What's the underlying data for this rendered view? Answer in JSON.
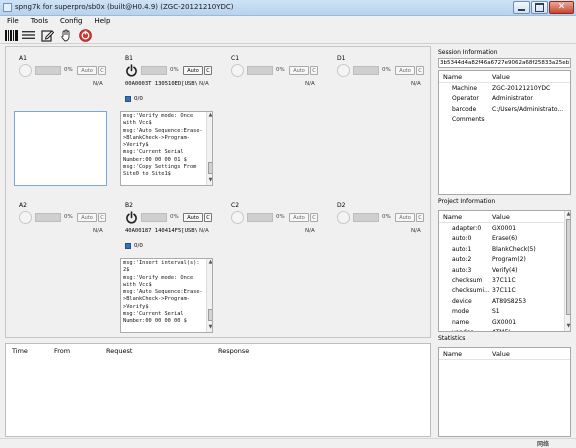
{
  "window": {
    "title": "spng7k for superpro/sb0x (built@H0.4.9) (ZGC-20121210YDC)"
  },
  "menu": [
    "File",
    "Tools",
    "Config",
    "Help"
  ],
  "toolbar": {
    "icons": [
      "barcode-icon",
      "list-icon",
      "edit-icon",
      "hand-icon",
      "stop-icon"
    ]
  },
  "sites": {
    "A1": {
      "label": "A1",
      "pct": "0%",
      "auto": "Auto",
      "c": "C",
      "status": "N/A"
    },
    "B1": {
      "label": "B1",
      "pct": "0%",
      "auto": "Auto",
      "c": "C",
      "status": "N/A",
      "serial": "00A0003T   130510ED[USB\\VID_",
      "count": "0/0",
      "log": "msg:'Verify mode: Once\nwith Vcc$\nmsg:'Auto Sequence:Erase-\n>BlankCheck->Program-\n>Verify$\nmsg:'Current Serial\nNumber:00 00 00 01 $\nmsg:'Copy Settings From\nSite0 to Site1$"
    },
    "C1": {
      "label": "C1",
      "pct": "0%",
      "auto": "Auto",
      "c": "C",
      "status": "N/A"
    },
    "D1": {
      "label": "D1",
      "pct": "0%",
      "auto": "Auto",
      "c": "C",
      "status": "N/A"
    },
    "A2": {
      "label": "A2",
      "pct": "0%",
      "auto": "Auto",
      "c": "C",
      "status": "N/A"
    },
    "B2": {
      "label": "B2",
      "pct": "0%",
      "auto": "Auto",
      "c": "C",
      "status": "N/A",
      "serial": "40A00187   140414F5[USB\\VID_",
      "count": "0/0",
      "log": "msg:'Insert interval(s):\n2$\nmsg:'Verify mode: Once\nwith Vcc$\nmsg:'Auto Sequence:Erase-\n>BlankCheck->Program-\n>Verify$\nmsg:'Current Serial\nNumber:00 00 00 00 $"
    },
    "C2": {
      "label": "C2",
      "pct": "0%",
      "auto": "Auto",
      "c": "C",
      "status": "N/A"
    },
    "D2": {
      "label": "D2",
      "pct": "0%",
      "auto": "Auto",
      "c": "C",
      "status": "N/A"
    }
  },
  "log_table": {
    "columns": [
      "Time",
      "From",
      "Request",
      "Response"
    ]
  },
  "session": {
    "title": "Session Information",
    "id": "3b5344d4a82f46a6727e9062a68f25833a25eb1e",
    "columns": [
      "Name",
      "Value"
    ],
    "rows": [
      {
        "name": "Machine",
        "value": "ZGC-20121210YDC"
      },
      {
        "name": "Operator",
        "value": "Administrator"
      },
      {
        "name": "barcode",
        "value": "C:/Users/Administrato..."
      },
      {
        "name": "Comments",
        "value": ""
      }
    ]
  },
  "project": {
    "title": "Project Information",
    "columns": [
      "Name",
      "Value"
    ],
    "rows": [
      {
        "name": "adapter:0",
        "value": "GX0001"
      },
      {
        "name": "auto:0",
        "value": "Erase(6)"
      },
      {
        "name": "auto:1",
        "value": "BlankCheck(5)"
      },
      {
        "name": "auto:2",
        "value": "Program(2)"
      },
      {
        "name": "auto:3",
        "value": "Verify(4)"
      },
      {
        "name": "checksum",
        "value": "37C11C"
      },
      {
        "name": "checksumi...",
        "value": "37C11C"
      },
      {
        "name": "device",
        "value": "AT89S8253"
      },
      {
        "name": "mode",
        "value": "S1"
      },
      {
        "name": "name",
        "value": "GX0001"
      },
      {
        "name": "vendor",
        "value": "ATMEL"
      }
    ]
  },
  "statistics": {
    "title": "Statistics",
    "columns": [
      "Name",
      "Value"
    ]
  },
  "statusbar": {
    "text": "网络"
  },
  "colors": {
    "title_bar": "#bcd6ee",
    "active_border": "#7aa7d6",
    "stop_red": "#d6332b"
  }
}
